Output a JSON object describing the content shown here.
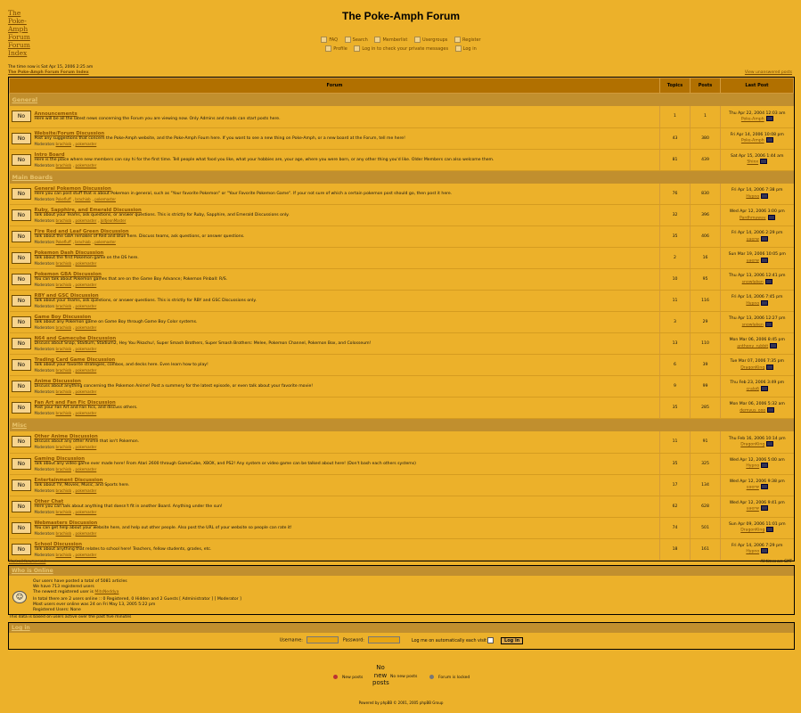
{
  "header": {
    "logo_alt": "The Poke-Amph Forum Forum Index",
    "title": "The Poke-Amph Forum",
    "nav_row1": [
      "FAQ",
      "Search",
      "Memberlist",
      "Usergroups",
      "Register"
    ],
    "nav_row2": [
      "Profile",
      "Log in to check your private messages",
      "Log in"
    ]
  },
  "time_now": "The time now is Sat Apr 15, 2006 2:25 am",
  "forum_index": "The Poke-Amph Forum Forum Index",
  "view_unanswered": "View unanswered posts",
  "table": {
    "col_forum": "Forum",
    "col_topics": "Topics",
    "col_posts": "Posts",
    "col_last": "Last Post",
    "no_icon_label": "No"
  },
  "categories": [
    {
      "name": "General",
      "forums": [
        {
          "name": "Announcements",
          "desc": "Here will be all the latest news concerning the Forum you are viewing now. Only Admins and mods can start posts here.",
          "mods": [],
          "topics": "1",
          "posts": "1",
          "last_date": "Thu Apr 22, 2004 12:03 am",
          "last_user": "Poke-Amph"
        },
        {
          "name": "Website/Forum Discussion",
          "desc": "Post any suggestions that concern the Poke-Amph website, and the Poke-Amph Foum here. If you want to see a new thing on Poke-Amph, or a new board at the Forum, tell me here!",
          "mods": [
            "brachiob",
            "pokemaster"
          ],
          "topics": "43",
          "posts": "380",
          "last_date": "Fri Apr 14, 2006 10:08 pm",
          "last_user": "Poke-Amph"
        },
        {
          "name": "Intro Board",
          "desc": "Here is the place where new members can say hi for the first time. Tell people what food you like, what your hobbies are, your age, where you were born, or any other thing you'd like. Older Members can also welcome them.",
          "mods": [
            "brachiob",
            "pokemaster"
          ],
          "topics": "81",
          "posts": "439",
          "last_date": "Sat Apr 15, 2006 1:44 am",
          "last_user": "Shinx"
        }
      ]
    },
    {
      "name": "Main Boards",
      "forums": [
        {
          "name": "General Pokemon Discussion",
          "desc": "Here you can post stuff that is about Pokemon in general, such as \"Your favorite Pokemon\" or \"Your Favorite Pokemon Game\". If your not sure of which a certain pokemon post should go, then post it here.",
          "mods": [
            "Pokefluff",
            "brachiob",
            "pokemaster"
          ],
          "topics": "76",
          "posts": "830",
          "last_date": "Fri Apr 14, 2006 7:38 pm",
          "last_user": "Hypno"
        },
        {
          "name": "Ruby, Sapphire, and Emerald Discussion",
          "desc": "Talk about your Teams, ask questions, or answer questions. This is strictly for Ruby, Sapphire, and Emerald Discussions only.",
          "mods": [
            "brachiob",
            "pokemaster",
            "JoltjeonMaster"
          ],
          "topics": "32",
          "posts": "396",
          "last_date": "Wed Apr 12, 2006 3:00 pm",
          "last_user": "Pardhmaway"
        },
        {
          "name": "Fire Red and Leaf Green Discussion",
          "desc": "Talk about the GBA remakes of Red and Blue here. Discuss teams, ask questions, or answer questions.",
          "mods": [
            "Pokefluff",
            "brachiob",
            "pokemaster"
          ],
          "topics": "35",
          "posts": "406",
          "last_date": "Fri Apr 14, 2006 2:29 pm",
          "last_user": "uaerw"
        },
        {
          "name": "Pokemon Dash Discussion",
          "desc": "Talk about the first Pokemon game on the DS here.",
          "mods": [
            "brachiob",
            "pokemaster"
          ],
          "topics": "2",
          "posts": "16",
          "last_date": "Sun Mar 19, 2006 10:05 pm",
          "last_user": "uaerw"
        },
        {
          "name": "Pokemon GBA Discussion",
          "desc": "You can talk about Pokemon games that are on the Game Boy Advance; Pokemon Pinball: R/S.",
          "mods": [
            "brachiob",
            "pokemaster"
          ],
          "topics": "10",
          "posts": "95",
          "last_date": "Thu Apr 13, 2006 12:41 pm",
          "last_user": "snowlaken"
        },
        {
          "name": "RBY and GSC Discussion",
          "desc": "Talk about your Teams, ask questions, or answer questions. This is strictly for RBY and GSC Discussions only.",
          "mods": [
            "brachiob",
            "pokemaster"
          ],
          "topics": "11",
          "posts": "116",
          "last_date": "Fri Apr 14, 2006 7:45 pm",
          "last_user": "Hypno"
        },
        {
          "name": "Game Boy Discussion",
          "desc": "Talk about any Pokemon game on Game Boy through Game Boy Color systems.",
          "mods": [
            "brachiob",
            "pokemaster"
          ],
          "topics": "3",
          "posts": "29",
          "last_date": "Thu Apr 13, 2006 12:27 pm",
          "last_user": "snowlaken"
        },
        {
          "name": "N64 and Gamecube Discussion",
          "desc": "Discuss about Snap, Stadium, Stadium2, Hey You Pikachu!, Super Smash Brothers, Super Smash Brothers: Melee, Pokemon Channel, Pokemon Box, and Colosseum!",
          "mods": [
            "brachiob",
            "pokemaster"
          ],
          "topics": "13",
          "posts": "110",
          "last_date": "Mon Mar 06, 2006 8:45 pm",
          "last_user": "anthony_rubbit"
        },
        {
          "name": "Trading Card Game Discussion",
          "desc": "Talk about your favorite strategies, combos, and decks here. Even learn how to play!",
          "mods": [
            "brachiob",
            "pokemaster"
          ],
          "topics": "6",
          "posts": "39",
          "last_date": "Tue Mar 07, 2006 7:35 pm",
          "last_user": "DragonKing"
        },
        {
          "name": "Anime Discussion",
          "desc": "Discuss about anything concerning the Pokemon Anime! Post a summery for the latest episode, or even talk about your favorite movie!",
          "mods": [
            "brachiob",
            "pokemaster"
          ],
          "topics": "9",
          "posts": "99",
          "last_date": "Thu Feb 23, 2006 3:49 pm",
          "last_user": "cralo6"
        },
        {
          "name": "Fan Art and Fan Fic Discussion",
          "desc": "Post your Fan Art and Fan Fics, and discuss others.",
          "mods": [
            "brachiob",
            "pokemaster"
          ],
          "topics": "35",
          "posts": "285",
          "last_date": "Mon Mar 06, 2006 5:32 am",
          "last_user": "demyus_ooo"
        }
      ]
    },
    {
      "name": "Misc",
      "forums": [
        {
          "name": "Other Anime Discussion",
          "desc": "Discuss about any other Anime that isn't Pokemon.",
          "mods": [
            "brachiob",
            "pokemaster"
          ],
          "topics": "11",
          "posts": "91",
          "last_date": "Thu Feb 16, 2006 10:14 pm",
          "last_user": "DragonKing"
        },
        {
          "name": "Gaming Discussion",
          "desc": "Talk about any video game ever made here! From Atari 2600 through GameCube, XBOX, and PS2! Any system or video game can be talked about here! (Don't bash each others systems)",
          "mods": [
            "brachiob",
            "pokemaster"
          ],
          "topics": "35",
          "posts": "325",
          "last_date": "Wed Apr 12, 2006 5:00 am",
          "last_user": "Hypno"
        },
        {
          "name": "Entertainment Discussion",
          "desc": "Talk about TV, Movies, Music, and Sports here.",
          "mods": [
            "brachiob",
            "pokemaster"
          ],
          "topics": "17",
          "posts": "134",
          "last_date": "Wed Apr 12, 2006 9:38 pm",
          "last_user": "uaerw"
        },
        {
          "name": "Other Chat",
          "desc": "Here you can talk about anything that doesn't fit in another Board. Anything under the sun!",
          "mods": [
            "brachiob",
            "pokemaster"
          ],
          "topics": "62",
          "posts": "628",
          "last_date": "Wed Apr 12, 2006 9:41 pm",
          "last_user": "uaerw"
        },
        {
          "name": "Webmasters Discussion",
          "desc": "You can get help about your website here, and help out other people. Also post the URL of your website so people can rate it!",
          "mods": [
            "brachiob",
            "pokemaster"
          ],
          "topics": "74",
          "posts": "501",
          "last_date": "Sun Apr 09, 2006 11:01 pm",
          "last_user": "DragonKing"
        },
        {
          "name": "School Discussion",
          "desc": "Talk about anything that relates to school here! Teachers, fellow students, grades, etc.",
          "mods": [
            "brachiob",
            "pokemaster"
          ],
          "topics": "18",
          "posts": "161",
          "last_date": "Fri Apr 14, 2006 7:29 pm",
          "last_user": "Hypno"
        }
      ]
    }
  ],
  "moderators_label": "Moderators",
  "mark_read": "Mark all forums read",
  "times_gmt": "All times are GMT",
  "whoonline": {
    "title": "Who is Online",
    "line1": "Our users have posted a total of 5081 articles",
    "line2": "We have 713 registered users",
    "line3": "The newest registered user is ",
    "newest_user": "MitsNeddya",
    "line4": "In total there are 2 users online :: 0 Registered, 0 Hidden and 2 Guests   [ Administrator ]   [ Moderator ]",
    "line5": "Most users ever online was 24 on Fri May 13, 2005 5:22 pm",
    "line6": "Registered Users: None"
  },
  "users_note": "This data is based on users active over the past five minutes",
  "login": {
    "title": "Log in",
    "username_label": "Username:",
    "password_label": "Password:",
    "auto_label": "Log me on automatically each visit",
    "button": "Log in"
  },
  "legend": {
    "new_posts": "New posts",
    "no_new_big": "No new posts",
    "no_new": "No new posts",
    "locked": "Forum is locked"
  },
  "powered": "Powered by phpBB © 2001, 2005 phpBB Group"
}
